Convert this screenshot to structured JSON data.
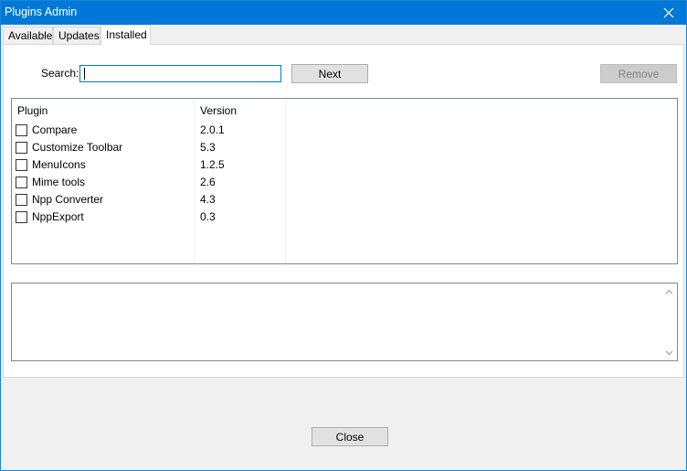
{
  "window": {
    "title": "Plugins Admin",
    "close_icon": "close-icon"
  },
  "tabs": [
    {
      "label": "Available",
      "active": false
    },
    {
      "label": "Updates",
      "active": false
    },
    {
      "label": "Installed",
      "active": true
    }
  ],
  "search": {
    "label": "Search:",
    "value": ""
  },
  "buttons": {
    "next": "Next",
    "remove": "Remove",
    "close": "Close"
  },
  "plugin_list": {
    "columns": [
      "Plugin",
      "Version"
    ],
    "rows": [
      {
        "name": "Compare",
        "version": "2.0.1",
        "checked": false
      },
      {
        "name": "Customize Toolbar",
        "version": "5.3",
        "checked": false
      },
      {
        "name": "MenuIcons",
        "version": "1.2.5",
        "checked": false
      },
      {
        "name": "Mime tools",
        "version": "2.6",
        "checked": false
      },
      {
        "name": "Npp Converter",
        "version": "4.3",
        "checked": false
      },
      {
        "name": "NppExport",
        "version": "0.3",
        "checked": false
      }
    ]
  },
  "description": {
    "text": ""
  },
  "colors": {
    "titlebar": "#0078d7",
    "focus_border": "#0078d7",
    "disabled_button": "#cccccc"
  }
}
